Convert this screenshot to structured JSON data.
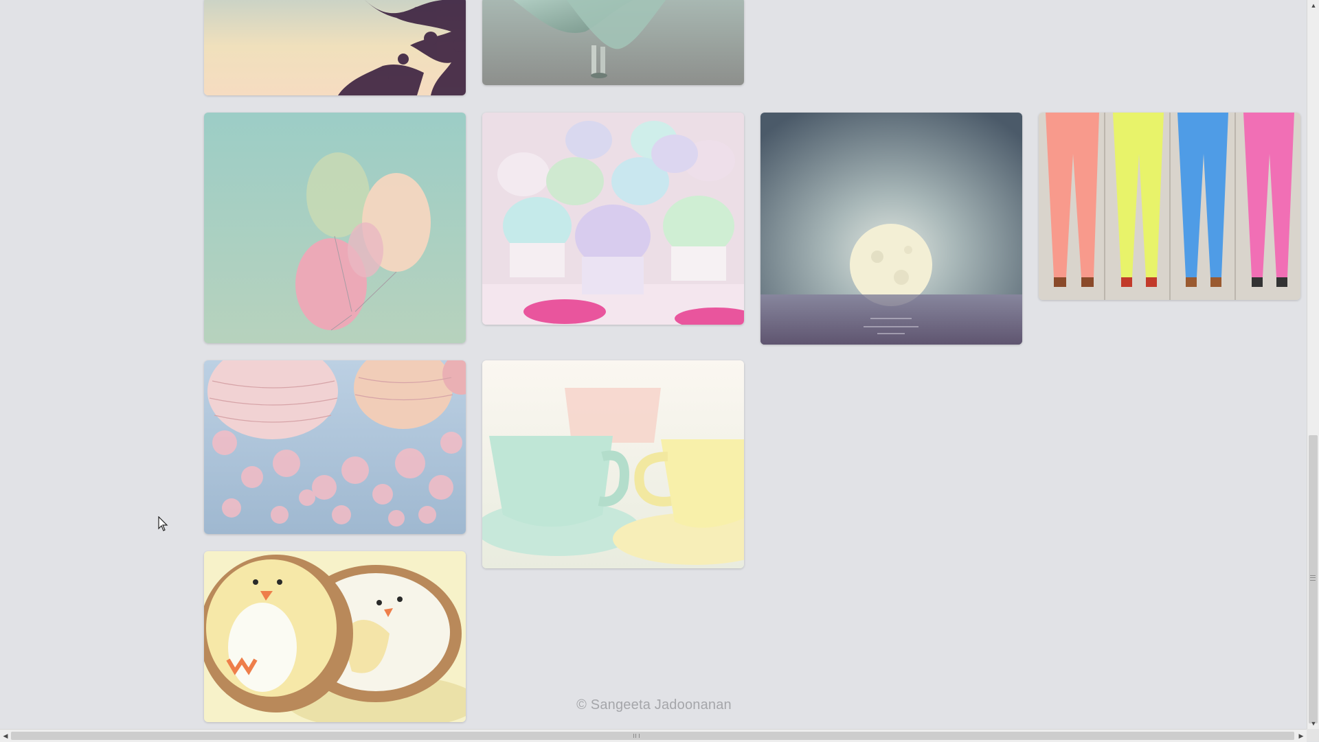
{
  "page": {
    "footer_text": "© Sangeeta Jadoonanan",
    "background_color": "#e1e2e6"
  },
  "gallery": {
    "tiles": [
      {
        "name": "tree-silhouette-sky-photo",
        "subject": "tree silhouette against pastel sky"
      },
      {
        "name": "flowing-mint-dress-photo",
        "subject": "flowing mint dress"
      },
      {
        "name": "pastel-balloons-photo",
        "subject": "pastel balloons"
      },
      {
        "name": "sugar-cupcakes-photo",
        "subject": "pastel sugar cupcakes"
      },
      {
        "name": "moon-over-sea-photo",
        "subject": "full moon over the sea"
      },
      {
        "name": "colored-jeans-photo",
        "subject": "colored skinny jeans"
      },
      {
        "name": "paper-lanterns-photo",
        "subject": "paper lanterns"
      },
      {
        "name": "pastel-teacups-photo",
        "subject": "pastel teacups"
      },
      {
        "name": "penguin-cookies-photo",
        "subject": "penguin cookies"
      }
    ]
  },
  "scrollbars": {
    "vertical": {
      "up_icon": "arrow-up-icon",
      "down_icon": "arrow-down-icon"
    },
    "horizontal": {
      "left_icon": "arrow-left-icon",
      "right_icon": "arrow-right-icon"
    }
  }
}
